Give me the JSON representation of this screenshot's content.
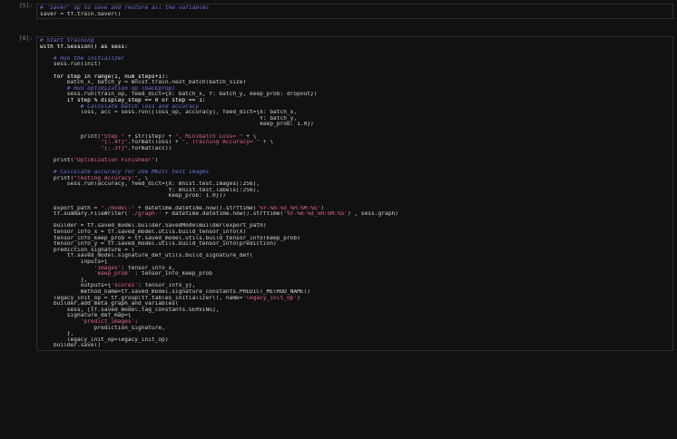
{
  "cells": [
    {
      "prompt": "[5]:",
      "lines": [
        [
          {
            "t": "# 'Saver' op to save and restore all the variables",
            "c": "c"
          }
        ],
        [
          {
            "t": "saver = tf.train.Saver()",
            "c": "n"
          }
        ]
      ]
    },
    {
      "prompt": "[6]:",
      "lines": [
        [
          {
            "t": "# Start training",
            "c": "c"
          }
        ],
        [
          {
            "t": "with tf.Session() as sess:",
            "c": "k"
          }
        ],
        [
          {
            "t": "",
            "c": "n"
          }
        ],
        [
          {
            "t": "    # Run the initializer",
            "c": "c"
          }
        ],
        [
          {
            "t": "    sess.run(init)",
            "c": "n"
          }
        ],
        [
          {
            "t": "",
            "c": "n"
          }
        ],
        [
          {
            "t": "    for step in range(1, num_steps+1):",
            "c": "k"
          }
        ],
        [
          {
            "t": "        batch_x, batch_y = mnist.train.next_batch(batch_size)",
            "c": "n"
          }
        ],
        [
          {
            "t": "        # Run optimization op (backprop)",
            "c": "c"
          }
        ],
        [
          {
            "t": "        sess.run(train_op, feed_dict={X: batch_x, Y: batch_y, keep_prob: dropout})",
            "c": "n"
          }
        ],
        [
          {
            "t": "        if step % display_step == 0 or step == 1:",
            "c": "k"
          }
        ],
        [
          {
            "t": "            # Calculate batch loss and accuracy",
            "c": "c"
          }
        ],
        [
          {
            "t": "            loss, acc = sess.run([loss_op, accuracy], feed_dict={X: batch_x,",
            "c": "n"
          }
        ],
        [
          {
            "t": "                                                                 Y: batch_y,",
            "c": "n"
          }
        ],
        [
          {
            "t": "                                                                 keep_prob: 1.0})",
            "c": "n"
          }
        ],
        [
          {
            "t": "",
            "c": "n"
          }
        ],
        [
          {
            "t": "            print(",
            "c": "n"
          },
          {
            "t": "\"Step \"",
            "c": "s"
          },
          {
            "t": " + str(step) + ",
            "c": "n"
          },
          {
            "t": "\", Minibatch Loss= \"",
            "c": "s"
          },
          {
            "t": " + \\",
            "c": "n"
          }
        ],
        [
          {
            "t": "                  ",
            "c": "n"
          },
          {
            "t": "\"{:.4f}\"",
            "c": "s"
          },
          {
            "t": ".format(loss) + ",
            "c": "n"
          },
          {
            "t": "\", Training Accuracy= \"",
            "c": "s"
          },
          {
            "t": " + \\",
            "c": "n"
          }
        ],
        [
          {
            "t": "                  ",
            "c": "n"
          },
          {
            "t": "\"{:.3f}\"",
            "c": "s"
          },
          {
            "t": ".format(acc))",
            "c": "n"
          }
        ],
        [
          {
            "t": "",
            "c": "n"
          }
        ],
        [
          {
            "t": "    print(",
            "c": "n"
          },
          {
            "t": "\"Optimization Finished!\"",
            "c": "s"
          },
          {
            "t": ")",
            "c": "n"
          }
        ],
        [
          {
            "t": "",
            "c": "n"
          }
        ],
        [
          {
            "t": "    # Calculate accuracy for 256 MNIST test images",
            "c": "c"
          }
        ],
        [
          {
            "t": "    print(",
            "c": "n"
          },
          {
            "t": "\"Testing Accuracy:\"",
            "c": "s"
          },
          {
            "t": ", \\",
            "c": "n"
          }
        ],
        [
          {
            "t": "        sess.run(accuracy, feed_dict={X: mnist.test.images[:256],",
            "c": "n"
          }
        ],
        [
          {
            "t": "                                      Y: mnist.test.labels[:256],",
            "c": "n"
          }
        ],
        [
          {
            "t": "                                      keep_prob: 1.0}))",
            "c": "n"
          }
        ],
        [
          {
            "t": "",
            "c": "n"
          }
        ],
        [
          {
            "t": "    export_path = ",
            "c": "n"
          },
          {
            "t": "\"./model-\"",
            "c": "s"
          },
          {
            "t": " + datetime.datetime.now().strftime(",
            "c": "n"
          },
          {
            "t": "'%Y-%m-%d_%H:%M:%S'",
            "c": "s"
          },
          {
            "t": ")",
            "c": "n"
          }
        ],
        [
          {
            "t": "    tf.summary.FileWriter(",
            "c": "n"
          },
          {
            "t": "'./graph-'",
            "c": "s"
          },
          {
            "t": " + datetime.datetime.now().strftime(",
            "c": "n"
          },
          {
            "t": "'%Y-%m-%d_%H:%M:%S'",
            "c": "s"
          },
          {
            "t": ") , sess.graph)",
            "c": "n"
          }
        ],
        [
          {
            "t": "",
            "c": "n"
          }
        ],
        [
          {
            "t": "    builder = tf.saved_model.builder.SavedModelBuilder(export_path)",
            "c": "n"
          }
        ],
        [
          {
            "t": "    tensor_info_x = tf.saved_model.utils.build_tensor_info(X)",
            "c": "n"
          }
        ],
        [
          {
            "t": "    tensor_info_keep_prob = tf.saved_model.utils.build_tensor_info(keep_prob)",
            "c": "n"
          }
        ],
        [
          {
            "t": "    tensor_info_y = tf.saved_model.utils.build_tensor_info(prediction)",
            "c": "n"
          }
        ],
        [
          {
            "t": "    prediction_signature = (",
            "c": "n"
          }
        ],
        [
          {
            "t": "        tf.saved_model.signature_def_utils.build_signature_def(",
            "c": "n"
          }
        ],
        [
          {
            "t": "            inputs={",
            "c": "n"
          }
        ],
        [
          {
            "t": "                ",
            "c": "n"
          },
          {
            "t": "'images'",
            "c": "s"
          },
          {
            "t": ": tensor_info_x,",
            "c": "n"
          }
        ],
        [
          {
            "t": "                ",
            "c": "n"
          },
          {
            "t": "'keep_prob'",
            "c": "s"
          },
          {
            "t": " : tensor_info_keep_prob",
            "c": "n"
          }
        ],
        [
          {
            "t": "            },",
            "c": "n"
          }
        ],
        [
          {
            "t": "            outputs={",
            "c": "n"
          },
          {
            "t": "'scores'",
            "c": "s"
          },
          {
            "t": ": tensor_info_y},",
            "c": "n"
          }
        ],
        [
          {
            "t": "            method_name=tf.saved_model.signature_constants.PREDICT_METHOD_NAME))",
            "c": "n"
          }
        ],
        [
          {
            "t": "    legacy_init_op = tf.group(tf.tables_initializer(), name=",
            "c": "n"
          },
          {
            "t": "'legacy_init_op'",
            "c": "s"
          },
          {
            "t": ")",
            "c": "n"
          }
        ],
        [
          {
            "t": "    builder.add_meta_graph_and_variables(",
            "c": "n"
          }
        ],
        [
          {
            "t": "        sess, [tf.saved_model.tag_constants.SERVING],",
            "c": "n"
          }
        ],
        [
          {
            "t": "        signature_def_map={",
            "c": "n"
          }
        ],
        [
          {
            "t": "            ",
            "c": "n"
          },
          {
            "t": "'predict_images'",
            "c": "s"
          },
          {
            "t": ":",
            "c": "n"
          }
        ],
        [
          {
            "t": "                prediction_signature,",
            "c": "n"
          }
        ],
        [
          {
            "t": "        },",
            "c": "n"
          }
        ],
        [
          {
            "t": "        legacy_init_op=legacy_init_op)",
            "c": "n"
          }
        ],
        [
          {
            "t": "    builder.save()",
            "c": "n"
          }
        ]
      ]
    }
  ]
}
